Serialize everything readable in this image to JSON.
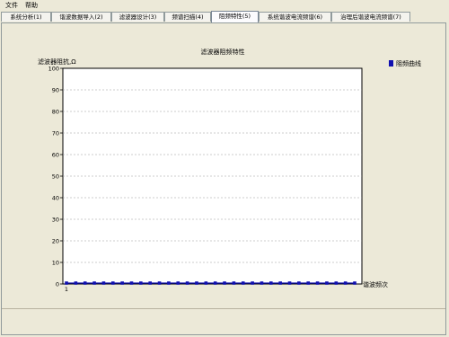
{
  "menu": {
    "file": "文件",
    "help": "帮助"
  },
  "tabs": [
    {
      "label": "系统分析(1)",
      "active": false
    },
    {
      "label": "谐波数据导入(2)",
      "active": false
    },
    {
      "label": "滤波器设计(3)",
      "active": false
    },
    {
      "label": "频谱扫描(4)",
      "active": false
    },
    {
      "label": "阻频特性(5)",
      "active": true
    },
    {
      "label": "系统谐波电流频谱(6)",
      "active": false
    },
    {
      "label": "治理后谐波电流频谱(7)",
      "active": false
    }
  ],
  "colors": {
    "series": "#1010b0",
    "grid": "#9a9a9a",
    "axis": "#000000"
  },
  "chart_data": {
    "type": "line",
    "title": "滤波器阻频特性",
    "ylabel": "滤波器阻抗,Ω",
    "xlabel": "谐波频次",
    "ylim": [
      0,
      100
    ],
    "yticks": [
      0,
      10,
      20,
      30,
      40,
      50,
      60,
      70,
      80,
      90,
      100
    ],
    "xtick_labels": [
      "1"
    ],
    "grid": true,
    "legend_position": "top-right",
    "series": [
      {
        "name": "阻频曲线",
        "color": "#1010b0",
        "x": [
          1,
          2,
          3,
          4,
          5,
          6,
          7,
          8,
          9,
          10,
          11,
          12,
          13,
          14,
          15,
          16,
          17,
          18,
          19,
          20,
          21,
          22,
          23,
          24,
          25,
          26,
          27,
          28,
          29,
          30,
          31,
          32
        ],
        "values": [
          0,
          0,
          0,
          0,
          0,
          0,
          0,
          0,
          0,
          0,
          0,
          0,
          0,
          0,
          0,
          0,
          0,
          0,
          0,
          0,
          0,
          0,
          0,
          0,
          0,
          0,
          0,
          0,
          0,
          0,
          0,
          0
        ]
      }
    ]
  }
}
